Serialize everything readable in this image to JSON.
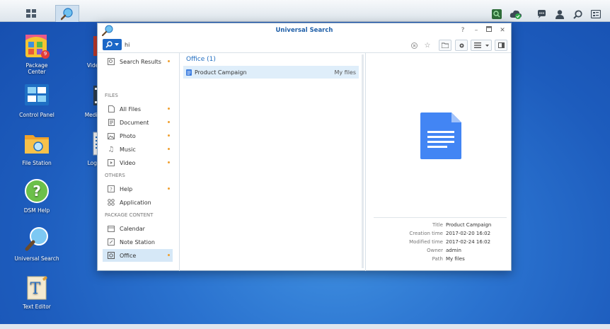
{
  "window": {
    "title": "Universal Search"
  },
  "search": {
    "query": "hi"
  },
  "sidebar": {
    "items": [
      {
        "label": "Search Results"
      },
      {
        "label": "All Files"
      },
      {
        "label": "Document"
      },
      {
        "label": "Photo"
      },
      {
        "label": "Music"
      },
      {
        "label": "Video"
      },
      {
        "label": "Help"
      },
      {
        "label": "Application"
      },
      {
        "label": "Calendar"
      },
      {
        "label": "Note Station"
      },
      {
        "label": "Office"
      }
    ],
    "sections": {
      "files": "FILES",
      "others": "OTHERS",
      "package": "PACKAGE CONTENT"
    }
  },
  "results": {
    "heading": "Office (1)",
    "rows": [
      {
        "name": "Product Campaign",
        "location": "My files"
      }
    ]
  },
  "preview": {
    "meta": [
      {
        "key": "Title",
        "value": "Product Campaign"
      },
      {
        "key": "Creation time",
        "value": "2017-02-20 16:02"
      },
      {
        "key": "Modified time",
        "value": "2017-02-24 16:02"
      },
      {
        "key": "Owner",
        "value": "admin"
      },
      {
        "key": "Path",
        "value": "My files"
      }
    ]
  },
  "desktop": {
    "icons": [
      {
        "label_line1": "Package",
        "label_line2": "Center",
        "badge": "9"
      },
      {
        "label_line1": "Control Panel"
      },
      {
        "label_line1": "File Station"
      },
      {
        "label_line1": "DSM Help"
      },
      {
        "label_line1": "Universal Search"
      },
      {
        "label_line1": "Text Editor"
      },
      {
        "label_line1": "Video St"
      },
      {
        "label_line1": "Media Se"
      },
      {
        "label_line1": "Log Cen"
      }
    ]
  },
  "colors": {
    "accent": "#1b67c7",
    "title": "#1f5fa8",
    "desktop": "#2a72cf"
  }
}
